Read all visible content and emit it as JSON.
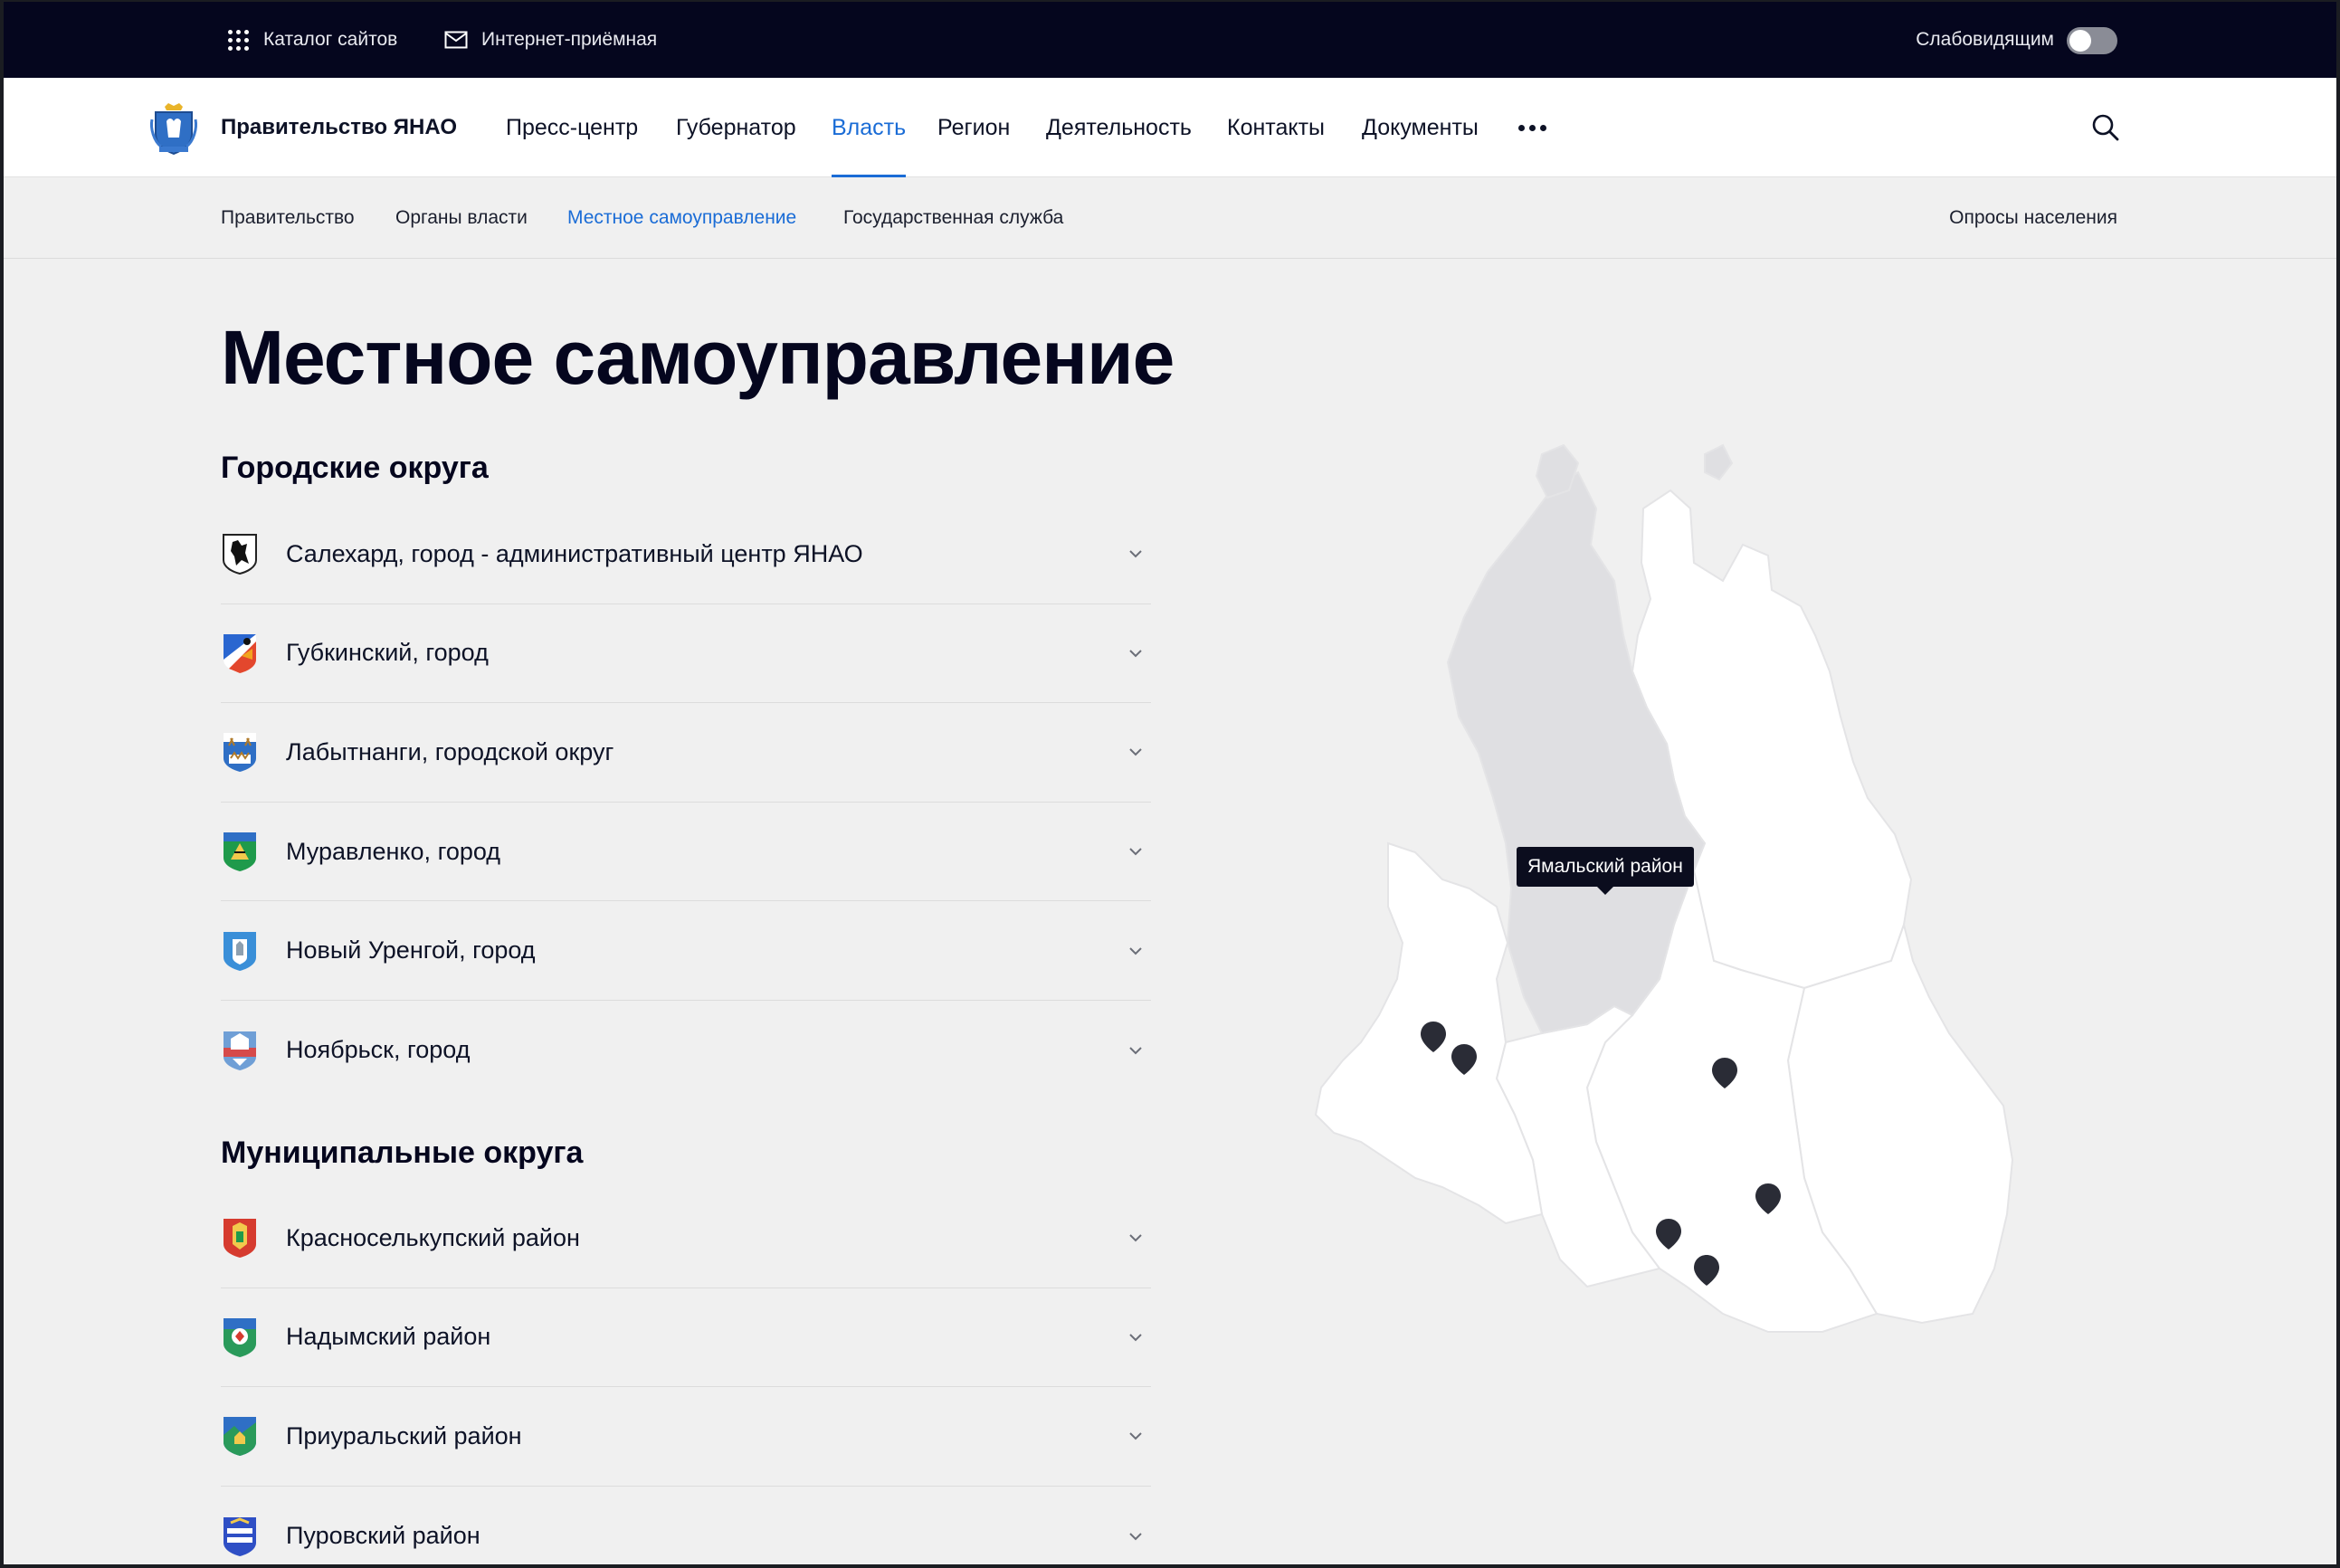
{
  "topbar": {
    "catalog_label": "Каталог сайтов",
    "reception_label": "Интернет-приёмная",
    "vision_label": "Слабовидящим"
  },
  "header": {
    "brand": "Правительство ЯНАО",
    "nav": [
      {
        "label": "Пресс-центр"
      },
      {
        "label": "Губернатор"
      },
      {
        "label": "Власть",
        "active": true
      },
      {
        "label": "Регион"
      },
      {
        "label": "Деятельность"
      },
      {
        "label": "Контакты"
      },
      {
        "label": "Документы"
      }
    ]
  },
  "subnav": {
    "items": [
      {
        "label": "Правительство"
      },
      {
        "label": "Органы власти"
      },
      {
        "label": "Местное самоуправление",
        "active": true
      },
      {
        "label": "Государственная служба"
      }
    ],
    "right_label": "Опросы населения"
  },
  "page": {
    "title": "Местное самоуправление",
    "urban_heading": "Городские округа",
    "urban": [
      {
        "label": "Салехард, город - административный центр ЯНАО"
      },
      {
        "label": "Губкинский, город"
      },
      {
        "label": "Лабытнанги, городской округ"
      },
      {
        "label": "Муравленко, город"
      },
      {
        "label": "Новый Уренгой, город"
      },
      {
        "label": "Ноябрьск, город"
      }
    ],
    "municipal_heading": "Муниципальные округа",
    "municipal": [
      {
        "label": "Красноселькупский район"
      },
      {
        "label": "Надымский район"
      },
      {
        "label": "Приуральский район"
      },
      {
        "label": "Пуровский район"
      }
    ]
  },
  "map": {
    "tooltip": "Ямальский район",
    "hover_fill": "#dfdfe2",
    "region_fill": "#ffffff",
    "marker_color": "#2a2c36"
  },
  "colors": {
    "topbar_bg": "#05061e",
    "accent": "#1a6cd6",
    "page_bg": "#f0f0f0"
  }
}
